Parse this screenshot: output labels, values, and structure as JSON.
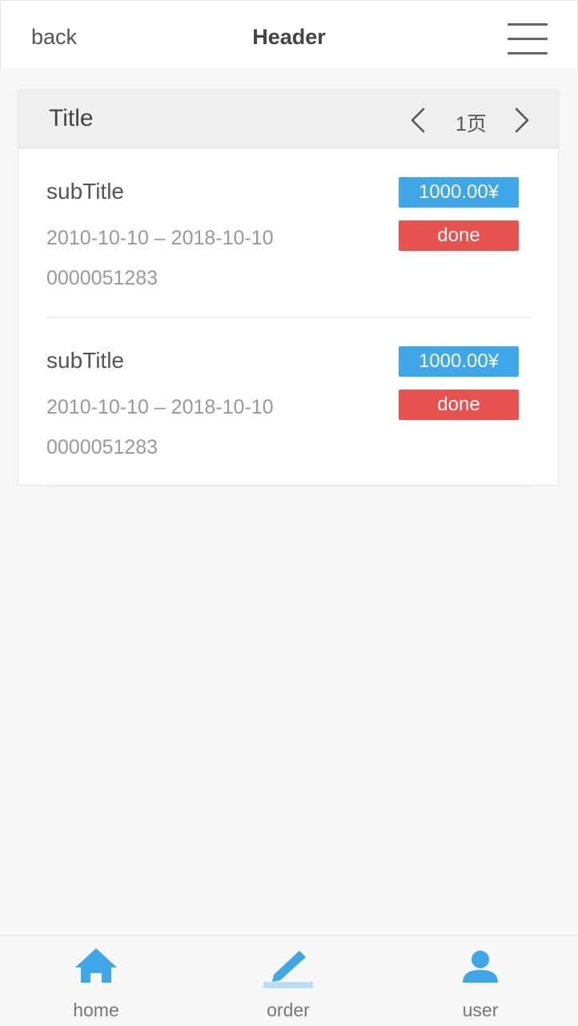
{
  "header": {
    "back_label": "back",
    "title": "Header",
    "menu_icon": "hamburger-menu-icon"
  },
  "card": {
    "title": "Title",
    "pager": {
      "prev_icon": "chevron-left-icon",
      "page_text": "1页",
      "next_icon": "chevron-right-icon"
    },
    "items": [
      {
        "subtitle": "subTitle",
        "date_range": "2010-10-10 – 2018-10-10",
        "order_no": "0000051283",
        "price": "1000.00¥",
        "status": "done"
      },
      {
        "subtitle": "subTitle",
        "date_range": "2010-10-10 – 2018-10-10",
        "order_no": "0000051283",
        "price": "1000.00¥",
        "status": "done"
      }
    ]
  },
  "tabbar": {
    "tabs": [
      {
        "label": "home",
        "icon": "home-icon"
      },
      {
        "label": "order",
        "icon": "pencil-icon"
      },
      {
        "label": "user",
        "icon": "user-icon"
      }
    ],
    "active_index": 1
  },
  "colors": {
    "accent": "#3fa7e7",
    "danger": "#e8534f",
    "background": "#f7f7f7"
  }
}
